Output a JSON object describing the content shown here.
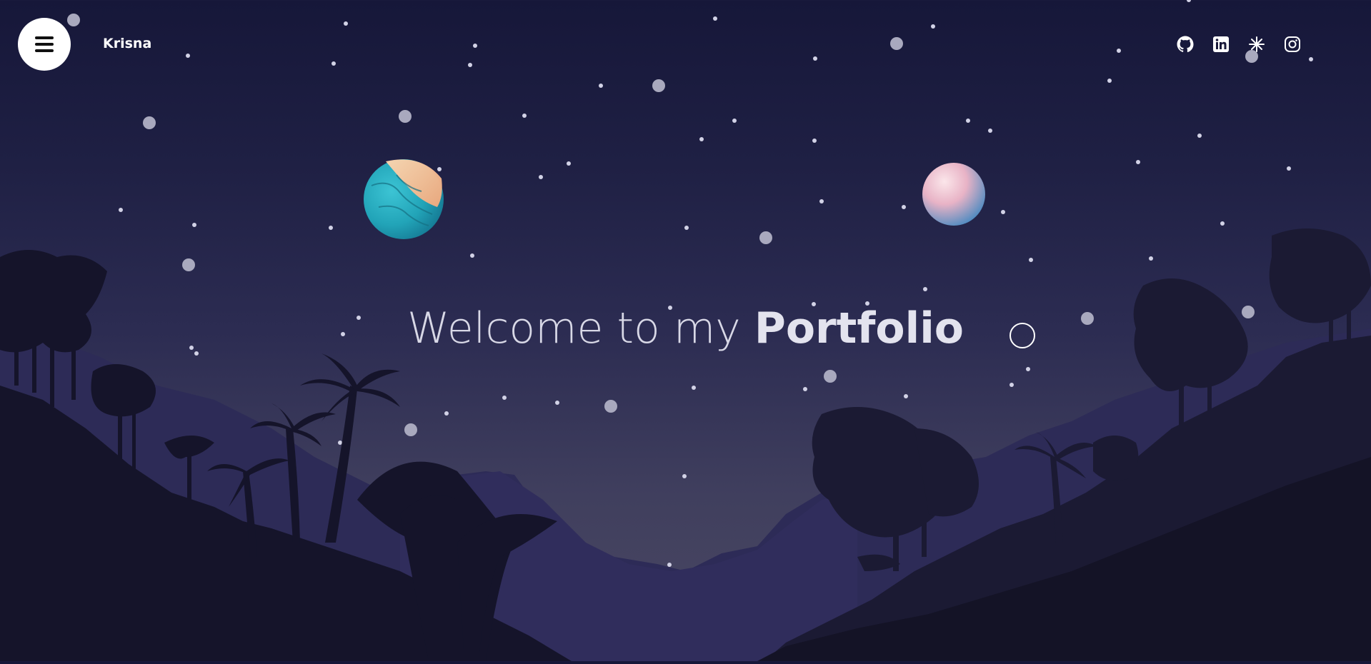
{
  "header": {
    "brand_name": "Krisna",
    "menu_icon": "hamburger-menu-icon"
  },
  "social_links": [
    {
      "name": "github",
      "icon": "github-icon"
    },
    {
      "name": "linkedin",
      "icon": "linkedin-icon"
    },
    {
      "name": "asterisk",
      "icon": "asterisk-icon"
    },
    {
      "name": "instagram",
      "icon": "instagram-icon"
    }
  ],
  "hero": {
    "welcome_text": "Welcome to my",
    "highlight_text": "Portfolio"
  },
  "colors": {
    "sky_top": "#161739",
    "sky_bottom": "#4a4862",
    "far_hills": "#2e2c57",
    "near_hills": "#14132a",
    "planet_left": "#1fa0b4",
    "planet_right": "#f0c8d8"
  }
}
